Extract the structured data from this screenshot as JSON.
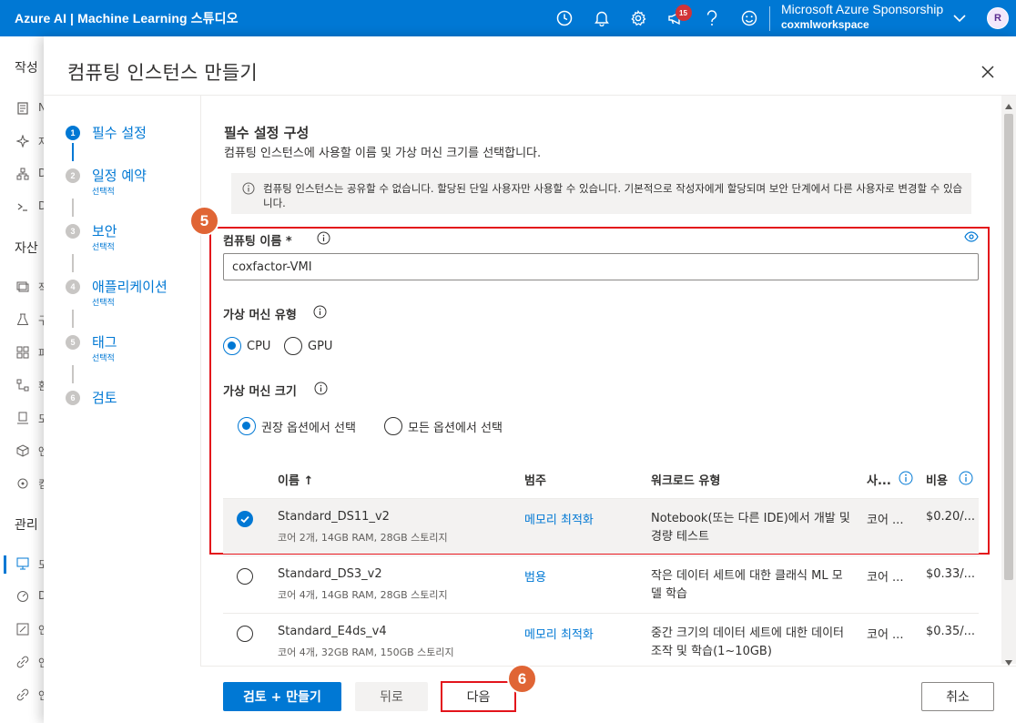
{
  "topbar": {
    "brand": "Azure AI | Machine Learning 스튜디오",
    "notification_count": "15",
    "account_name": "Microsoft Azure Sponsorship",
    "workspace": "coxmlworkspace",
    "avatar_initial": "R",
    "icons": [
      "clock-icon",
      "bell-icon",
      "gear-icon",
      "megaphone-icon",
      "help-icon",
      "smiley-icon"
    ]
  },
  "bgnav": {
    "section_author": "작성",
    "section_assets": "자산",
    "section_manage": "관리",
    "items": [
      "N",
      "자",
      "D",
      ">_ 프",
      "D",
      "작",
      "구",
      "파",
      "환",
      "모",
      "엔",
      "컴",
      "모",
      "D",
      "연",
      "연"
    ]
  },
  "panel": {
    "title": "컴퓨팅 인스턴스 만들기"
  },
  "steps": [
    {
      "num": "1",
      "label": "필수 설정",
      "sub": ""
    },
    {
      "num": "2",
      "label": "일정 예약",
      "sub": "선택적"
    },
    {
      "num": "3",
      "label": "보안",
      "sub": "선택적"
    },
    {
      "num": "4",
      "label": "애플리케이션",
      "sub": "선택적"
    },
    {
      "num": "5",
      "label": "태그",
      "sub": "선택적"
    },
    {
      "num": "6",
      "label": "검토",
      "sub": ""
    }
  ],
  "form": {
    "heading": "필수 설정 구성",
    "description": "컴퓨팅 인스턴스에 사용할 이름 및 가상 머신 크기를 선택합니다.",
    "info_text": "컴퓨팅 인스턴스는 공유할 수 없습니다. 할당된 단일 사용자만 사용할 수 있습니다. 기본적으로 작성자에게 할당되며 보안 단계에서 다른 사용자로 변경할 수 있습니다.",
    "compute_name_label": "컴퓨팅 이름 *",
    "compute_name_value": "coxfactor-VMI",
    "vm_type_label": "가상 머신 유형",
    "vm_type_options": [
      "CPU",
      "GPU"
    ],
    "vm_type_selected": "CPU",
    "vm_size_label": "가상 머신 크기",
    "vm_size_options": [
      "권장 옵션에서 선택",
      "모든 옵션에서 선택"
    ],
    "vm_size_selected": "권장 옵션에서 선택"
  },
  "table": {
    "headers": {
      "name": "이름 ↑",
      "category": "범주",
      "workload": "워크로드 유형",
      "availability": "사...",
      "cost": "비용"
    },
    "rows": [
      {
        "name": "Standard_DS11_v2",
        "spec": "코어 2개, 14GB RAM, 28GB 스토리지",
        "category": "메모리 최적화",
        "workload": "Notebook(또는 다른 IDE)에서 개발 및 경량 테스트",
        "availability": "코어 ...",
        "cost": "$0.20/...",
        "selected": true
      },
      {
        "name": "Standard_DS3_v2",
        "spec": "코어 4개, 14GB RAM, 28GB 스토리지",
        "category": "범용",
        "workload": "작은 데이터 세트에 대한 클래식 ML 모델 학습",
        "availability": "코어 ...",
        "cost": "$0.33/...",
        "selected": false
      },
      {
        "name": "Standard_E4ds_v4",
        "spec": "코어 4개, 32GB RAM, 150GB 스토리지",
        "category": "메모리 최적화",
        "workload": "중간 크기의 데이터 세트에 대한 데이터 조작 및 학습(1~10GB)",
        "availability": "코어 ...",
        "cost": "$0.35/...",
        "selected": false
      }
    ]
  },
  "footer": {
    "review_create": "검토 + 만들기",
    "back": "뒤로",
    "next": "다음",
    "cancel": "취소"
  },
  "callouts": {
    "c5": "5",
    "c6": "6"
  },
  "colors": {
    "accent": "#0078d4",
    "annotation_red": "#e3141b",
    "callout": "#e06535"
  }
}
